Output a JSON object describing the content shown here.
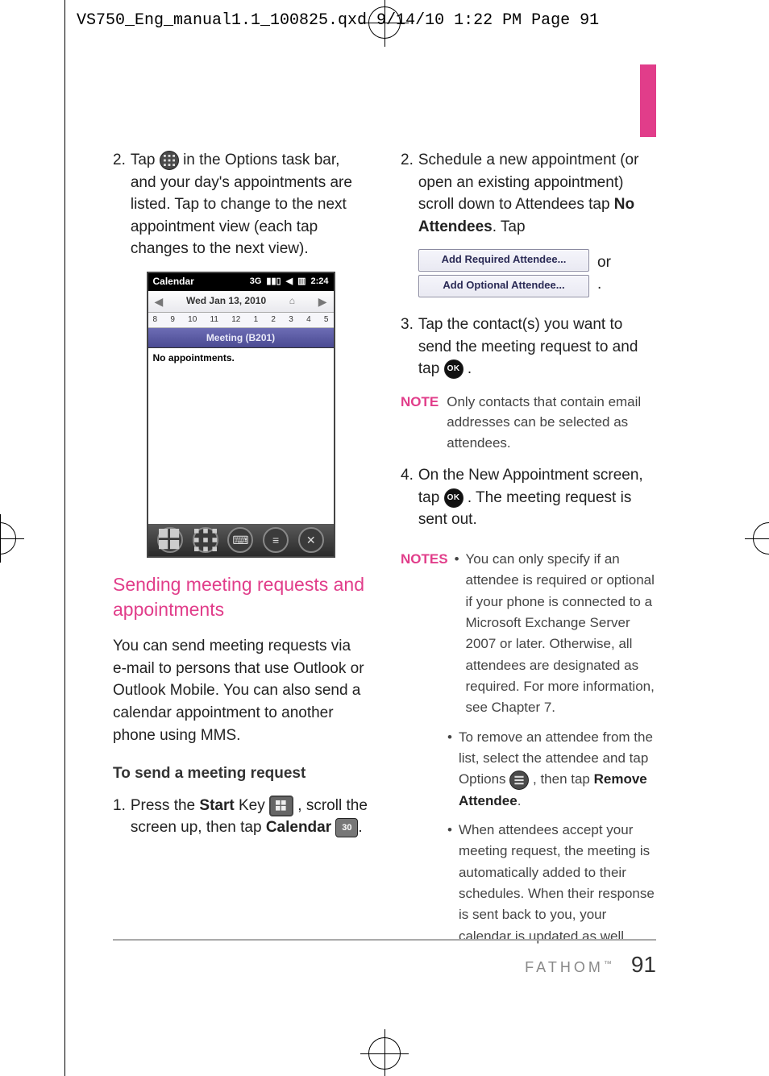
{
  "slug": "VS750_Eng_manual1.1_100825.qxd  9/14/10  1:22 PM  Page 91",
  "accent": "#e13d8a",
  "footer": {
    "brand": "FATHOM",
    "tm": "™",
    "page": "91"
  },
  "left": {
    "step2": {
      "num": "2.",
      "pre": "Tap ",
      "post": " in the Options task bar, and your day's appointments are listed. Tap to change to the next appointment view (each tap changes to the next view)."
    },
    "heading": "Sending meeting requests and appointments",
    "intro": "You can send meeting requests via e-mail to persons that use Outlook or Outlook Mobile. You can also send a calendar appointment to another phone using MMS.",
    "sub": "To send a meeting request",
    "step1": {
      "num": "1.",
      "a": "Press the ",
      "b": "Start",
      "c": " Key ",
      "d": ", scroll the screen up, then tap ",
      "e": "Calendar",
      "f": " ",
      "g": "."
    },
    "cal_label": "30"
  },
  "phone": {
    "title": "Calendar",
    "status": {
      "net": "3G",
      "time": "2:24"
    },
    "date": "Wed Jan 13, 2010",
    "days": [
      "8",
      "9",
      "10",
      "11",
      "12",
      "1",
      "2",
      "3",
      "4",
      "5"
    ],
    "meeting": "Meeting (B201)",
    "empty": "No appointments."
  },
  "right": {
    "step2": {
      "num": "2.",
      "a": "Schedule a new appointment (or open an existing appointment) scroll down to Attendees tap ",
      "b": "No Attendees",
      "c": ". Tap"
    },
    "btn_required": "Add Required Attendee...",
    "or": "or",
    "btn_optional": "Add Optional Attendee...",
    "dot": ".",
    "step3": {
      "num": "3.",
      "a": "Tap the contact(s) you want to send the meeting request to and tap ",
      "b": "."
    },
    "ok": "OK",
    "note1_label": "NOTE",
    "note1": "Only contacts that contain email addresses can be selected as attendees.",
    "step4": {
      "num": "4.",
      "a": "On the New Appointment screen, tap ",
      "b": ". The meeting request is sent out."
    },
    "notes_label": "NOTES",
    "notes": {
      "n1": "You can only specify if an attendee is required or optional if your phone is connected to a Microsoft Exchange Server 2007 or later. Otherwise, all attendees are designated as required. For more information, see Chapter 7.",
      "n2a": "To remove an attendee from the list, select the attendee and tap Options ",
      "n2b": ", then tap ",
      "n2c": "Remove Attendee",
      "n2d": ".",
      "n3": "When attendees accept your meeting request, the meeting is automatically added to their schedules. When their response is sent back to you, your calendar is updated as well."
    }
  }
}
